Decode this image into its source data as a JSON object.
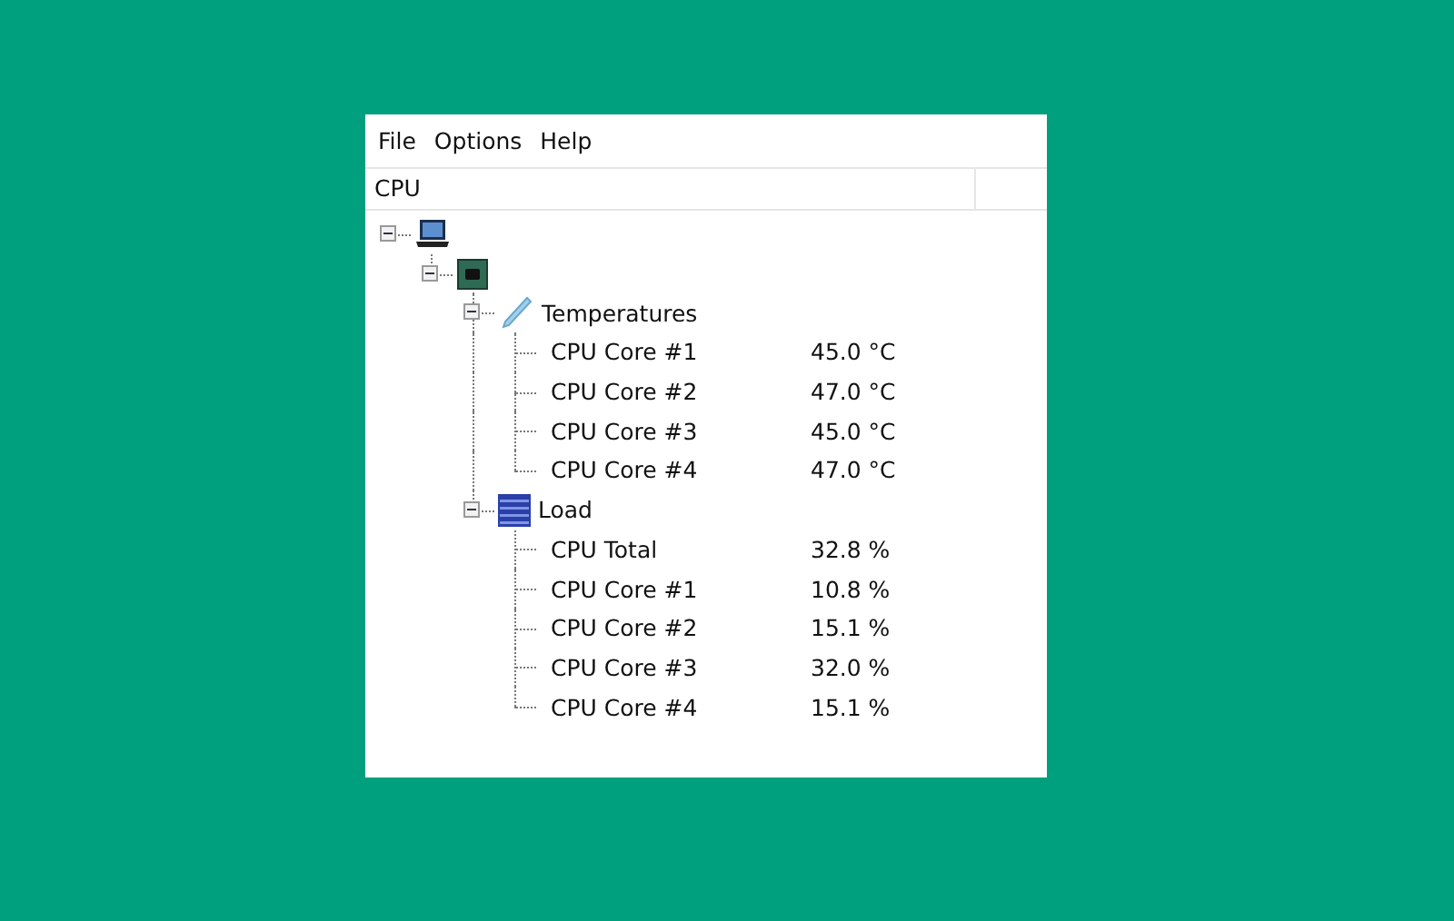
{
  "menu": [
    {
      "label": "File"
    },
    {
      "label": "Options"
    },
    {
      "label": "Help"
    }
  ],
  "columns": [
    {
      "label": "CPU"
    }
  ],
  "tree": [
    {
      "kind": "computer",
      "expanded": true,
      "children": [
        {
          "kind": "chip",
          "expanded": true,
          "children": [
            {
              "kind": "temperature",
              "label": "Temperatures",
              "expanded": true,
              "children": [
                {
                  "label": "CPU Core #1",
                  "value": "45.0 °C"
                },
                {
                  "label": "CPU Core #2",
                  "value": "47.0 °C"
                },
                {
                  "label": "CPU Core #3",
                  "value": "45.0 °C"
                },
                {
                  "label": "CPU Core #4",
                  "value": "47.0 °C"
                }
              ]
            },
            {
              "kind": "load",
              "label": "Load",
              "expanded": true,
              "children": [
                {
                  "label": "CPU Total",
                  "value": "32.8 %"
                },
                {
                  "label": "CPU Core #1",
                  "value": "10.8 %"
                },
                {
                  "label": "CPU Core #2",
                  "value": "15.1 %"
                },
                {
                  "label": "CPU Core #3",
                  "value": "32.0 %"
                },
                {
                  "label": "CPU Core #4",
                  "value": "15.1 %"
                }
              ]
            }
          ]
        }
      ]
    }
  ]
}
